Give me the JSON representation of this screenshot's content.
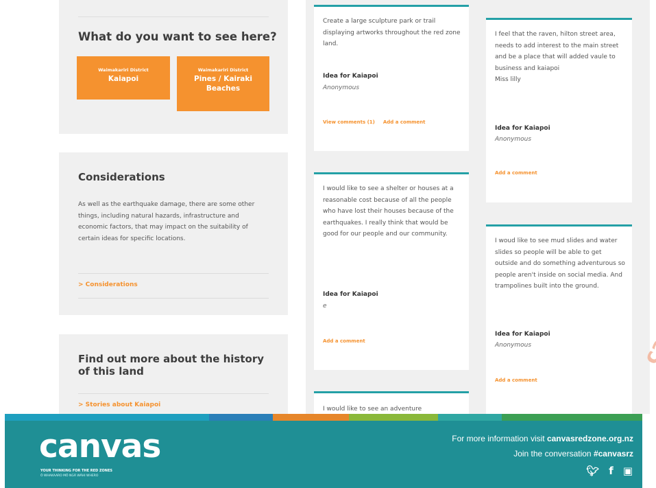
{
  "want": {
    "title": "What do you want to see here?",
    "btn1_small": "Waimakariri District",
    "btn1_big": "Kaiapoi",
    "btn2_small": "Waimakariri District",
    "btn2_big": "Pines / Kairaki Beaches"
  },
  "considerations": {
    "title": "Considerations",
    "body": "As well as the earthquake damage, there are some other things, including natural hazards, infrastructure and economic factors, that may impact on the suitability of certain ideas for specific locations.",
    "link": "> Considerations"
  },
  "history": {
    "title": "Find out more about the history of this land",
    "link": "> Stories about Kaiapoi"
  },
  "cards": {
    "c1": {
      "text": "Create a large sculpture park or trail displaying artworks throughout the red zone land.",
      "idea": "Idea for Kaiapoi",
      "author": "Anonymous",
      "view": "View comments (1)",
      "add": "Add a comment"
    },
    "c2": {
      "text": "I feel that the raven, hilton street area, needs to add interest to the main street and be a place that will added vaule to business and kaiapoi\nMiss lilly",
      "idea": "Idea for Kaiapoi",
      "author": "Anonymous",
      "add": "Add a comment"
    },
    "c3": {
      "text": "I would like to see a shelter or houses at a reasonable cost because of all the people who have lost their houses because of the earthquakes. I really think that would be good for our people and our community.",
      "idea": "Idea for Kaiapoi",
      "author": "e",
      "add": "Add a comment"
    },
    "c4": {
      "text": "I woud like to see mud slides and water slides so people will be able to get outside and do something adventurous so people aren't inside on social media. And trampolines built into the ground.",
      "idea": "Idea for Kaiapoi",
      "author": "Anonymous",
      "add": "Add a comment"
    },
    "c5": {
      "text": "I would like to see an adventure"
    }
  },
  "footer": {
    "logo": "canvas",
    "tagline1": "YOUR THINKING FOR THE RED ZONES",
    "tagline2": "Ō WHAKAARO MŌ NGĀ WĀHI WHERO",
    "info_prefix": "For more information visit",
    "info_link": "canvasredzone.org.nz",
    "join_prefix": "Join the conversation",
    "hashtag": "#canvasrz",
    "icons": [
      "twitter-icon",
      "facebook-icon",
      "instagram-icon"
    ]
  },
  "colors": {
    "accent": "#f5922f",
    "teal": "#1f8f95",
    "card_border": "#24a0a6"
  }
}
